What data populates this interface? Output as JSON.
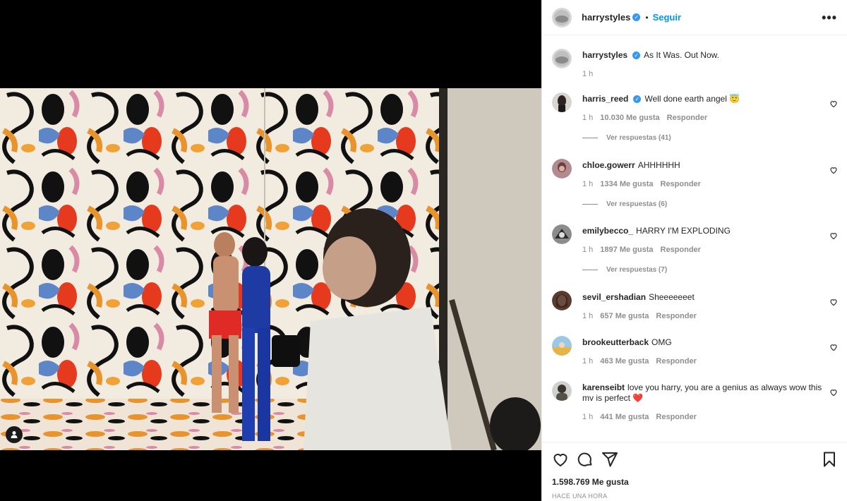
{
  "post": {
    "author": "harrystyles",
    "follow_label": "Seguir",
    "dot": "•",
    "more_label": "•••",
    "caption": "As It Was. Out Now.",
    "caption_time": "1 h"
  },
  "comments": [
    {
      "user": "harris_reed",
      "verified": true,
      "text": "Well done earth angel 😇",
      "time": "1 h",
      "likes": "10.030 Me gusta",
      "reply": "Responder",
      "view_replies": "Ver respuestas (41)"
    },
    {
      "user": "chloe.gowerr",
      "verified": false,
      "text": "AHHHHHH",
      "time": "1 h",
      "likes": "1334 Me gusta",
      "reply": "Responder",
      "view_replies": "Ver respuestas (6)"
    },
    {
      "user": "emilybecco_",
      "verified": false,
      "text": "HARRY I'M EXPLODING",
      "time": "1 h",
      "likes": "1897 Me gusta",
      "reply": "Responder",
      "view_replies": "Ver respuestas (7)"
    },
    {
      "user": "sevil_ershadian",
      "verified": false,
      "text": "Sheeeeeeet",
      "time": "1 h",
      "likes": "657 Me gusta",
      "reply": "Responder",
      "view_replies": ""
    },
    {
      "user": "brookeutterback",
      "verified": false,
      "text": "OMG",
      "time": "1 h",
      "likes": "463 Me gusta",
      "reply": "Responder",
      "view_replies": ""
    },
    {
      "user": "karenseibt",
      "verified": false,
      "text": "love you harry, you are a genius as always wow this mv is perfect ❤️",
      "time": "1 h",
      "likes": "441 Me gusta",
      "reply": "Responder",
      "view_replies": ""
    }
  ],
  "footer": {
    "likes": "1.598.769 Me gusta",
    "posted": "HACE UNA HORA"
  },
  "icons": {
    "like": "heart-icon",
    "comment": "comment-icon",
    "share": "paper-plane-icon",
    "save": "bookmark-icon",
    "tag": "user-tag-icon",
    "verified": "verified-badge-icon"
  },
  "colors": {
    "accent": "#0095f6",
    "verified": "#3897f0",
    "muted": "#8e8e8e",
    "text": "#262626"
  }
}
